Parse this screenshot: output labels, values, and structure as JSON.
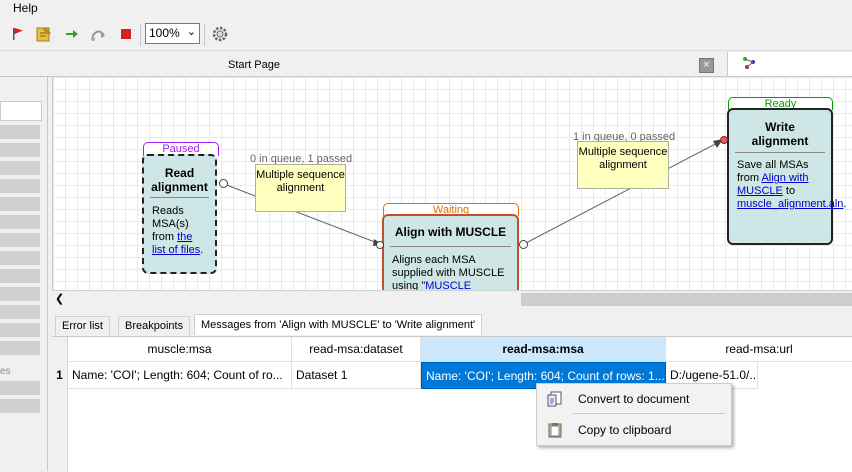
{
  "menubar": {
    "help": "Help"
  },
  "toolbar": {
    "zoom_value": "100%",
    "icons": [
      "run-flag-icon",
      "validate-icon",
      "next-step-icon",
      "step-over-icon",
      "stop-icon",
      "settings-gear-icon"
    ]
  },
  "tabs": {
    "start_page": "Start Page"
  },
  "left_panel": {
    "fragment": "es"
  },
  "workflow": {
    "read": {
      "state": "Paused",
      "title": "Read alignment",
      "desc_prefix": "Reads MSA(s) from ",
      "desc_link": "the list of files",
      "desc_suffix": "."
    },
    "align": {
      "state": "Waiting",
      "title": "Align with MUSCLE",
      "desc_prefix": "Aligns each MSA supplied with MUSCLE using \"",
      "desc_link": "MUSCLE default",
      "desc_suffix": "\""
    },
    "write": {
      "state": "Ready",
      "title": "Write alignment",
      "desc_prefix": "Save all MSAs from ",
      "desc_link1": "Align with MUSCLE",
      "desc_mid": " to ",
      "desc_link2": "muscle_alignment.aln",
      "desc_suffix": "."
    },
    "link1": {
      "queue": "0 in queue, 1 passed",
      "note": "Multiple sequence alignment"
    },
    "link2": {
      "queue": "1 in queue, 0 passed",
      "note": "Multiple sequence alignment"
    }
  },
  "bottom_tabs": {
    "error_list": "Error list",
    "breakpoints": "Breakpoints",
    "messages": "Messages from 'Align with MUSCLE' to 'Write alignment'"
  },
  "table": {
    "columns": [
      "muscle:msa",
      "read-msa:dataset",
      "read-msa:msa",
      "read-msa:url"
    ],
    "rows": [
      {
        "index": "1",
        "cells": [
          "Name: 'COI'; Length: 604; Count of ro...",
          "Dataset 1",
          "Name: 'COI'; Length: 604; Count of rows: 1...",
          "D:/ugene-51.0/..."
        ]
      }
    ]
  },
  "context_menu": {
    "items": [
      {
        "label": "Convert to document",
        "icon": "convert-document-icon"
      },
      {
        "label": "Copy to clipboard",
        "icon": "clipboard-icon"
      }
    ]
  },
  "colors": {
    "paused": "#a020f0",
    "waiting": "#e07000",
    "ready": "#00a000",
    "node_fill": "#cfe6e6",
    "selection": "#0078d7"
  }
}
